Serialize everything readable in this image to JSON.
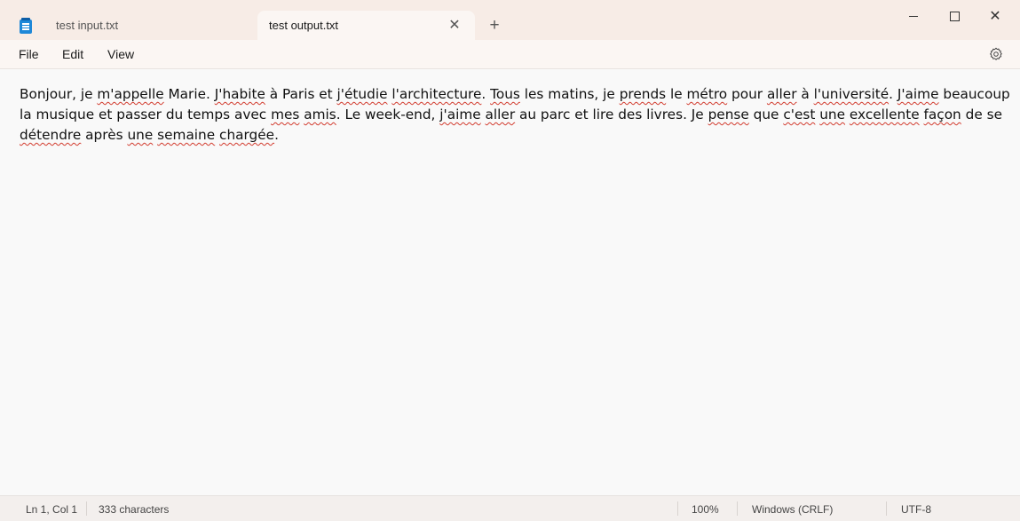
{
  "tabs": [
    {
      "label": "test input.txt",
      "active": false
    },
    {
      "label": "test output.txt",
      "active": true
    }
  ],
  "tab_close_glyph": "✕",
  "new_tab_glyph": "+",
  "window_controls": {
    "close_glyph": "✕"
  },
  "menu": {
    "file": "File",
    "edit": "Edit",
    "view": "View"
  },
  "icons": {
    "app": "notepad-icon",
    "settings": "gear-icon"
  },
  "editor": {
    "segments": [
      {
        "text": "Bonjour, je ",
        "flag": false
      },
      {
        "text": "m'appelle",
        "flag": true
      },
      {
        "text": " Marie. ",
        "flag": false
      },
      {
        "text": "J'habite",
        "flag": true
      },
      {
        "text": " à Paris et ",
        "flag": false
      },
      {
        "text": "j'étudie",
        "flag": true
      },
      {
        "text": " ",
        "flag": false
      },
      {
        "text": "l'architecture",
        "flag": true
      },
      {
        "text": ". ",
        "flag": false
      },
      {
        "text": "Tous",
        "flag": true
      },
      {
        "text": " les matins, je ",
        "flag": false
      },
      {
        "text": "prends",
        "flag": true
      },
      {
        "text": " le ",
        "flag": false
      },
      {
        "text": "métro",
        "flag": true
      },
      {
        "text": " pour ",
        "flag": false
      },
      {
        "text": "aller",
        "flag": true
      },
      {
        "text": " à ",
        "flag": false
      },
      {
        "text": "l'université",
        "flag": true
      },
      {
        "text": ". ",
        "flag": false
      },
      {
        "text": "J'aime",
        "flag": true
      },
      {
        "text": " beaucoup la musique et passer du temps avec ",
        "flag": false
      },
      {
        "text": "mes",
        "flag": true
      },
      {
        "text": " ",
        "flag": false
      },
      {
        "text": "amis",
        "flag": true
      },
      {
        "text": ". Le week-end, ",
        "flag": false
      },
      {
        "text": "j'aime",
        "flag": true
      },
      {
        "text": " ",
        "flag": false
      },
      {
        "text": "aller",
        "flag": true
      },
      {
        "text": " au parc et lire des livres. Je ",
        "flag": false
      },
      {
        "text": "pense",
        "flag": true
      },
      {
        "text": " que ",
        "flag": false
      },
      {
        "text": "c'est",
        "flag": true
      },
      {
        "text": " ",
        "flag": false
      },
      {
        "text": "une",
        "flag": true
      },
      {
        "text": " ",
        "flag": false
      },
      {
        "text": "excellente",
        "flag": true
      },
      {
        "text": " ",
        "flag": false
      },
      {
        "text": "façon",
        "flag": true
      },
      {
        "text": " de se ",
        "flag": false
      },
      {
        "text": "détendre",
        "flag": true
      },
      {
        "text": " après ",
        "flag": false
      },
      {
        "text": "une",
        "flag": true
      },
      {
        "text": " ",
        "flag": false
      },
      {
        "text": "semaine",
        "flag": true
      },
      {
        "text": " ",
        "flag": false
      },
      {
        "text": "chargée",
        "flag": true
      },
      {
        "text": ".",
        "flag": false
      }
    ]
  },
  "status": {
    "position": "Ln 1, Col 1",
    "characters": "333 characters",
    "zoom": "100%",
    "line_ending": "Windows (CRLF)",
    "encoding": "UTF-8"
  },
  "colors": {
    "titlebar": "#f7ece6",
    "active_tab": "#fbf6f3",
    "spellcheck_underline": "#d23b2e",
    "editor_bg": "#f9f9f9"
  }
}
